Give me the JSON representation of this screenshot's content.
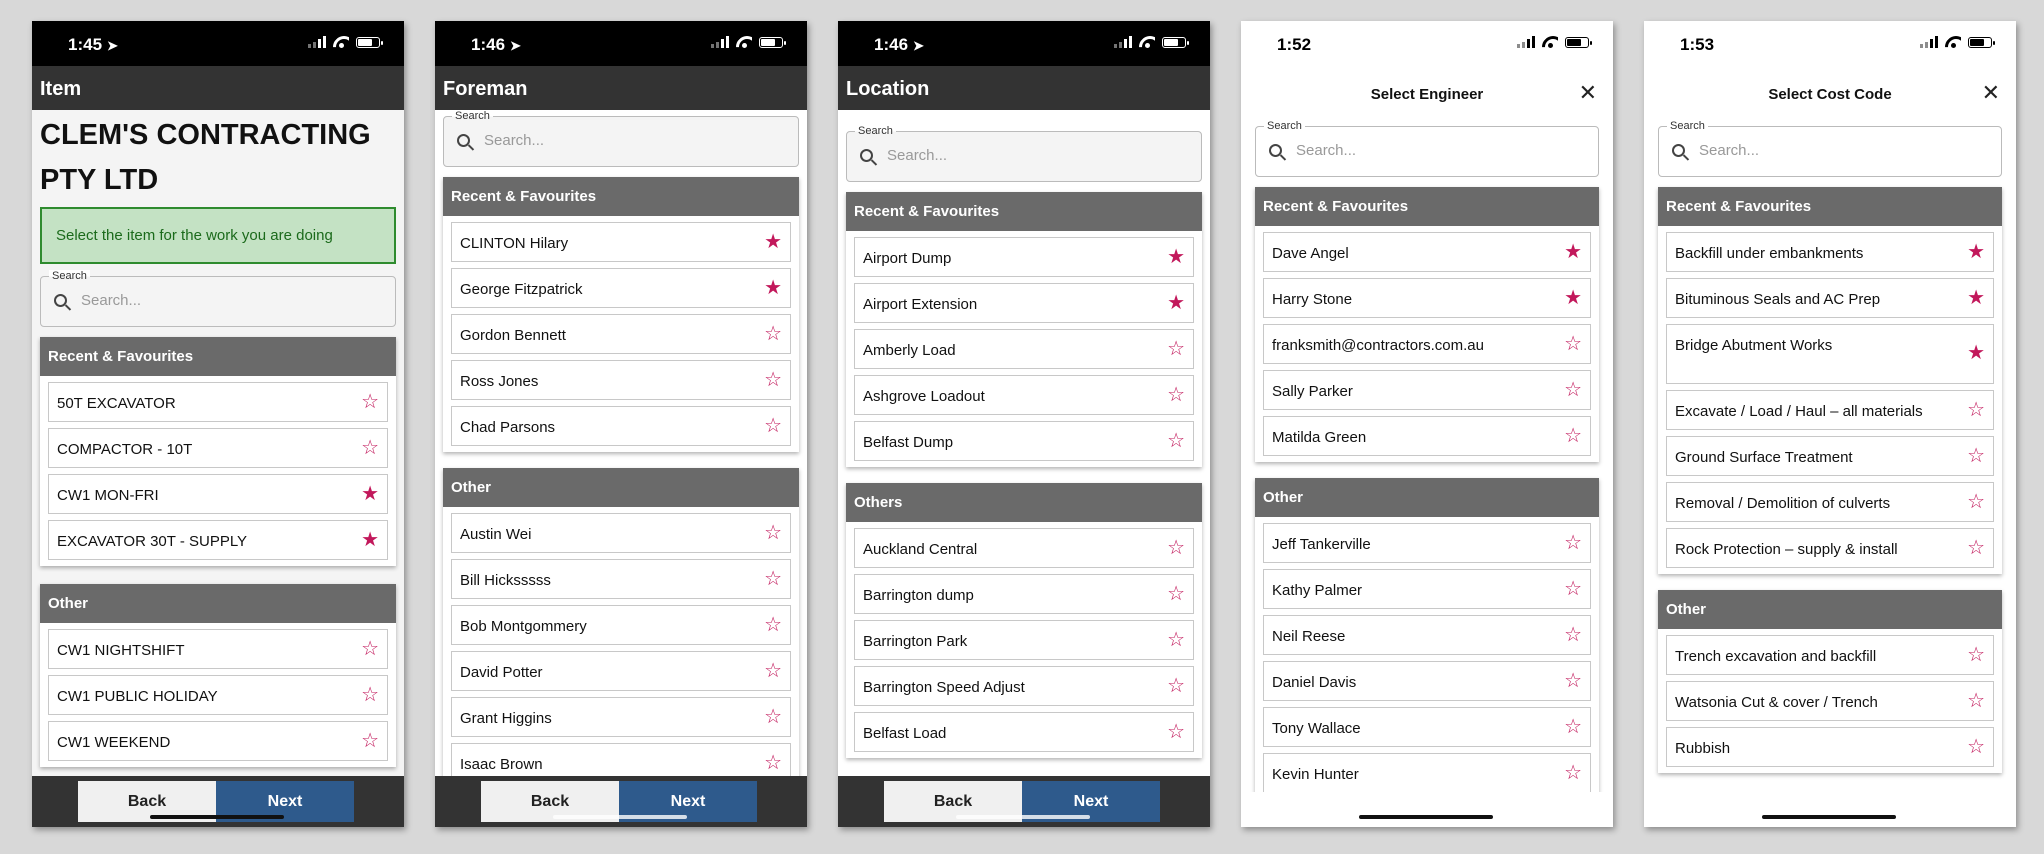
{
  "screens": [
    {
      "time": "1:45",
      "title": "Item",
      "company": "CLEM'S CONTRACTING PTY LTD",
      "info": "Select the item for the work you are doing",
      "search_label": "Search",
      "search_placeholder": "Search...",
      "recent_header": "Recent & Favourites",
      "recent": [
        {
          "label": "50T EXCAVATOR",
          "star": "☆"
        },
        {
          "label": "COMPACTOR - 10T",
          "star": "☆"
        },
        {
          "label": "CW1 MON-FRI",
          "star": "★"
        },
        {
          "label": "EXCAVATOR 30T - SUPPLY",
          "star": "★"
        }
      ],
      "other_header": "Other",
      "other": [
        {
          "label": "CW1 NIGHTSHIFT",
          "star": "☆"
        },
        {
          "label": "CW1 PUBLIC HOLIDAY",
          "star": "☆"
        },
        {
          "label": "CW1 WEEKEND",
          "star": "☆"
        }
      ],
      "back": "Back",
      "next": "Next"
    },
    {
      "time": "1:46",
      "title": "Foreman",
      "search_label": "Search",
      "search_placeholder": "Search...",
      "recent_header": "Recent & Favourites",
      "recent": [
        {
          "label": "CLINTON Hilary",
          "star": "★"
        },
        {
          "label": "George Fitzpatrick",
          "star": "★"
        },
        {
          "label": "Gordon Bennett",
          "star": "☆"
        },
        {
          "label": "Ross Jones",
          "star": "☆"
        },
        {
          "label": "Chad Parsons",
          "star": "☆"
        }
      ],
      "other_header": "Other",
      "other": [
        {
          "label": "Austin Wei",
          "star": "☆"
        },
        {
          "label": "Bill Hicksssss",
          "star": "☆"
        },
        {
          "label": "Bob Montgommery",
          "star": "☆"
        },
        {
          "label": "David Potter",
          "star": "☆"
        },
        {
          "label": "Grant Higgins",
          "star": "☆"
        },
        {
          "label": "Isaac Brown",
          "star": "☆"
        }
      ],
      "back": "Back",
      "next": "Next"
    },
    {
      "time": "1:46",
      "title": "Location",
      "search_label": "Search",
      "search_placeholder": "Search...",
      "recent_header": "Recent & Favourites",
      "recent": [
        {
          "label": "Airport Dump",
          "star": "★"
        },
        {
          "label": "Airport Extension",
          "star": "★"
        },
        {
          "label": "Amberly Load",
          "star": "☆"
        },
        {
          "label": "Ashgrove Loadout",
          "star": "☆"
        },
        {
          "label": "Belfast Dump",
          "star": "☆"
        }
      ],
      "other_header": "Others",
      "other": [
        {
          "label": "Auckland Central",
          "star": "☆"
        },
        {
          "label": "Barrington dump",
          "star": "☆"
        },
        {
          "label": "Barrington Park",
          "star": "☆"
        },
        {
          "label": "Barrington Speed Adjust",
          "star": "☆"
        },
        {
          "label": "Belfast Load",
          "star": "☆"
        }
      ],
      "back": "Back",
      "next": "Next"
    },
    {
      "time": "1:52",
      "title": "Select Engineer",
      "search_label": "Search",
      "search_placeholder": "Search...",
      "recent_header": "Recent & Favourites",
      "recent": [
        {
          "label": "Dave Angel",
          "star": "★"
        },
        {
          "label": "Harry Stone",
          "star": "★"
        },
        {
          "label": "franksmith@contractors.com.au",
          "star": "☆"
        },
        {
          "label": "Sally Parker",
          "star": "☆"
        },
        {
          "label": "Matilda Green",
          "star": "☆"
        }
      ],
      "other_header": "Other",
      "other": [
        {
          "label": "Jeff Tankerville",
          "star": "☆"
        },
        {
          "label": "Kathy Palmer",
          "star": "☆"
        },
        {
          "label": "Neil Reese",
          "star": "☆"
        },
        {
          "label": "Daniel Davis",
          "star": "☆"
        },
        {
          "label": "Tony Wallace",
          "star": "☆"
        },
        {
          "label": "Kevin Hunter",
          "star": "☆"
        }
      ]
    },
    {
      "time": "1:53",
      "title": "Select Cost Code",
      "search_label": "Search",
      "search_placeholder": "Search...",
      "recent_header": "Recent & Favourites",
      "recent": [
        {
          "label": "Backfill under embankments",
          "star": "★"
        },
        {
          "label": "Bituminous Seals and AC Prep",
          "star": "★"
        },
        {
          "label": "Bridge Abutment Works",
          "star": "★"
        },
        {
          "label": "Excavate / Load / Haul – all materials",
          "star": "☆"
        },
        {
          "label": "Ground Surface Treatment",
          "star": "☆"
        },
        {
          "label": "Removal / Demolition of culverts",
          "star": "☆"
        },
        {
          "label": "Rock Protection – supply & install",
          "star": "☆"
        }
      ],
      "other_header": "Other",
      "other": [
        {
          "label": "Trench excavation and backfill",
          "star": "☆"
        },
        {
          "label": "Watsonia Cut & cover / Trench",
          "star": "☆"
        },
        {
          "label": "Rubbish",
          "star": "☆"
        }
      ]
    }
  ]
}
